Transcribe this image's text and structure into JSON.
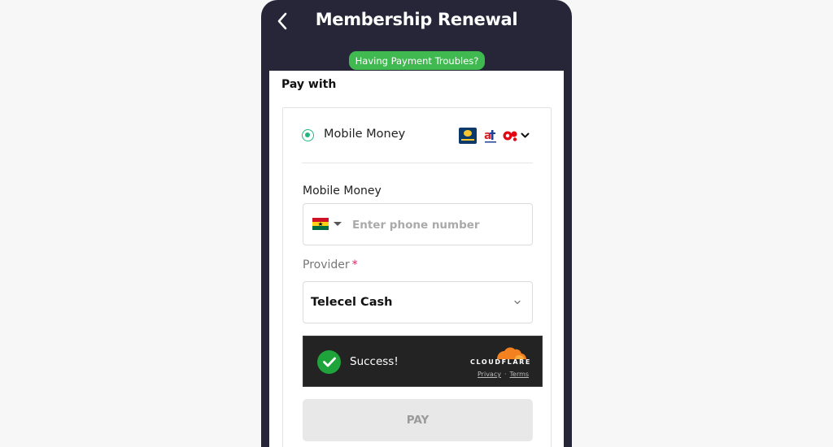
{
  "header": {
    "title": "Membership Renewal",
    "back_icon": "chevron-left-icon",
    "trouble_label": "Having Payment Troubles?"
  },
  "payment": {
    "pay_with_label": "Pay with",
    "method": {
      "label": "Mobile Money",
      "selected": true,
      "logos": [
        "mtn-momo-logo",
        "airteltigo-logo",
        "telecel-logo"
      ]
    },
    "mobile_money_label": "Mobile Money",
    "phone": {
      "country_flag": "ghana-flag-icon",
      "placeholder": "Enter phone number",
      "value": ""
    },
    "provider": {
      "label": "Provider",
      "required_mark": "*",
      "selected_value": "Telecel Cash"
    },
    "captcha": {
      "status_text": "Success!",
      "brand": "CLOUDFLARE",
      "privacy_link": "Privacy",
      "separator": "·",
      "terms_link": "Terms"
    },
    "pay_button_label": "PAY"
  },
  "colors": {
    "header_bg": "#262638",
    "pill_green": "#3fb950",
    "radio_green": "#1fb57f",
    "captcha_bg": "#232323",
    "success_green": "#1fa43b",
    "cloudflare_orange": "#f48120",
    "disabled_button_bg": "#e8e8e8"
  }
}
